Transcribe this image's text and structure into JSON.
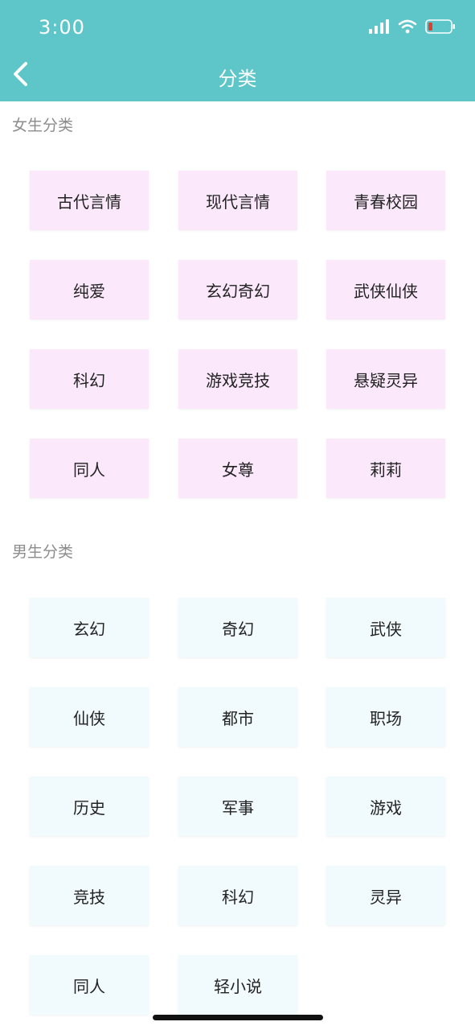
{
  "status_bar": {
    "time": "3:00",
    "icons": [
      "signal-icon",
      "wifi-icon",
      "battery-low-icon"
    ]
  },
  "nav": {
    "title": "分类",
    "back_icon": "chevron-left-icon"
  },
  "female_section": {
    "title": "女生分类",
    "items": [
      "古代言情",
      "现代言情",
      "青春校园",
      "纯爱",
      "玄幻奇幻",
      "武侠仙侠",
      "科幻",
      "游戏竞技",
      "悬疑灵异",
      "同人",
      "女尊",
      "莉莉"
    ]
  },
  "male_section": {
    "title": "男生分类",
    "items": [
      "玄幻",
      "奇幻",
      "武侠",
      "仙侠",
      "都市",
      "职场",
      "历史",
      "军事",
      "游戏",
      "竞技",
      "科幻",
      "灵异",
      "同人",
      "轻小说"
    ]
  },
  "colors": {
    "header_bg": "#5ec5c9",
    "female_tile": "#fbe9fb",
    "male_tile": "#f1fafd",
    "battery_low": "#e0412f"
  }
}
